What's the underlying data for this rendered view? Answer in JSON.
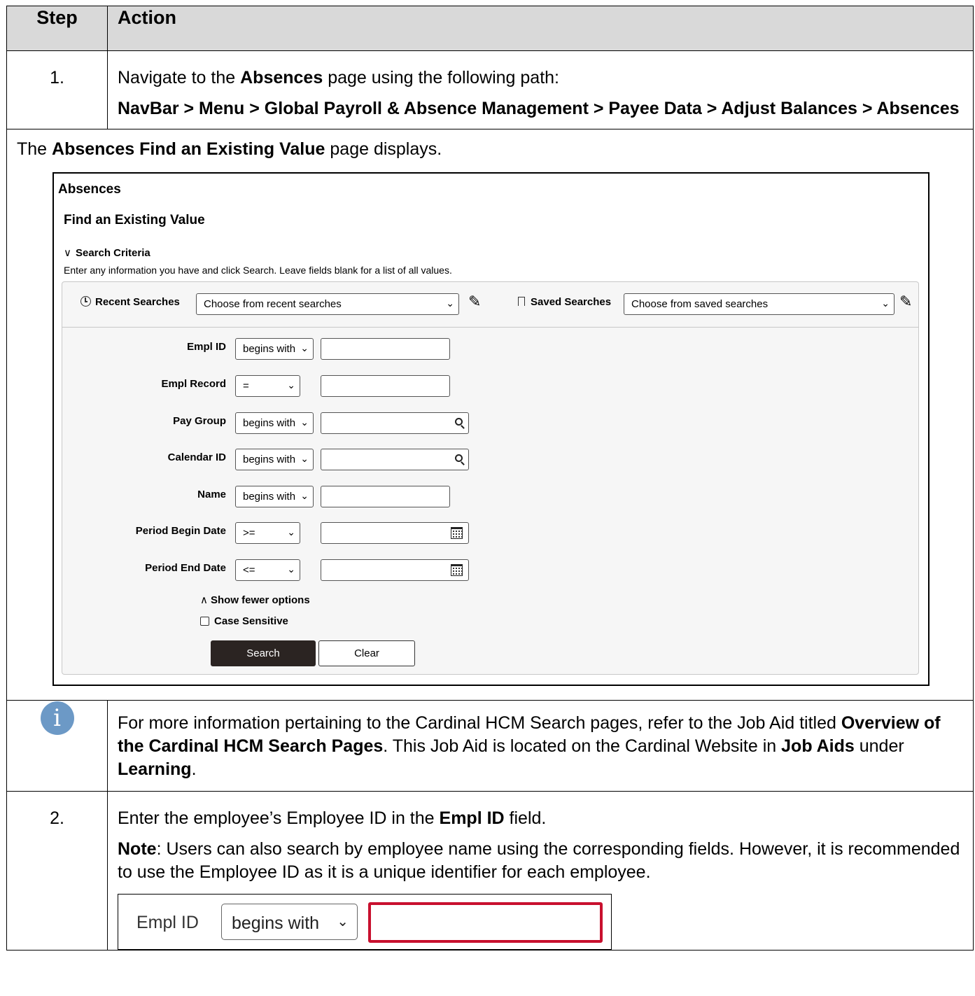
{
  "header": {
    "step": "Step",
    "action": "Action"
  },
  "step1": {
    "num": "1.",
    "line1_pre": "Navigate to the ",
    "line1_bold": "Absences",
    "line1_post": " page using the following path:",
    "path": "NavBar > Menu > Global Payroll & Absence Management > Payee Data > Adjust Balances > Absences"
  },
  "display": {
    "pre": "The ",
    "bold": "Absences Find an Existing Value",
    "post": " page displays."
  },
  "screenshot": {
    "title": "Absences",
    "subtitle": "Find an Existing Value",
    "search_criteria": "Search Criteria",
    "instructions": "Enter any information you have and click Search. Leave fields blank for a list of all values.",
    "recent_label": "Recent Searches",
    "recent_value": "Choose from recent searches",
    "saved_label": "Saved Searches",
    "saved_value": "Choose from saved searches",
    "fields": [
      {
        "label": "Empl ID",
        "operator": "begins with"
      },
      {
        "label": "Empl Record",
        "operator": "="
      },
      {
        "label": "Pay Group",
        "operator": "begins with"
      },
      {
        "label": "Calendar ID",
        "operator": "begins with"
      },
      {
        "label": "Name",
        "operator": "begins with"
      },
      {
        "label": "Period Begin Date",
        "operator": ">="
      },
      {
        "label": "Period End Date",
        "operator": "<="
      }
    ],
    "show_fewer": "Show fewer options",
    "case_sensitive": "Case Sensitive",
    "search_button": "Search",
    "clear_button": "Clear"
  },
  "info": {
    "t1": "For more information pertaining to the Cardinal HCM Search pages, refer to the Job Aid titled ",
    "b1": "Overview of the Cardinal HCM Search Pages",
    "t2": ". This Job Aid is located on the Cardinal Website in ",
    "b2": "Job Aids",
    "t3": " under ",
    "b3": "Learning",
    "t4": "."
  },
  "step2": {
    "num": "2.",
    "line1_pre": "Enter the employee’s Employee ID in the ",
    "line1_bold": "Empl ID",
    "line1_post": " field.",
    "note_label": "Note",
    "note_text": ": Users can also search by employee name using the corresponding fields. However, it is recommended to use the Employee ID as it is a unique identifier for each employee.",
    "zoom_label": "Empl ID",
    "zoom_operator": "begins with"
  },
  "icons": {
    "info": "info-icon",
    "history": "history-icon",
    "bookmark": "bookmark-icon",
    "pencil": "pencil-icon",
    "search": "search-icon",
    "calendar": "calendar-icon"
  },
  "colors": {
    "header_bg": "#d9d9d9",
    "info_icon": "#6c99c6",
    "search_button": "#2b2422",
    "highlight_border": "#c8102e"
  }
}
